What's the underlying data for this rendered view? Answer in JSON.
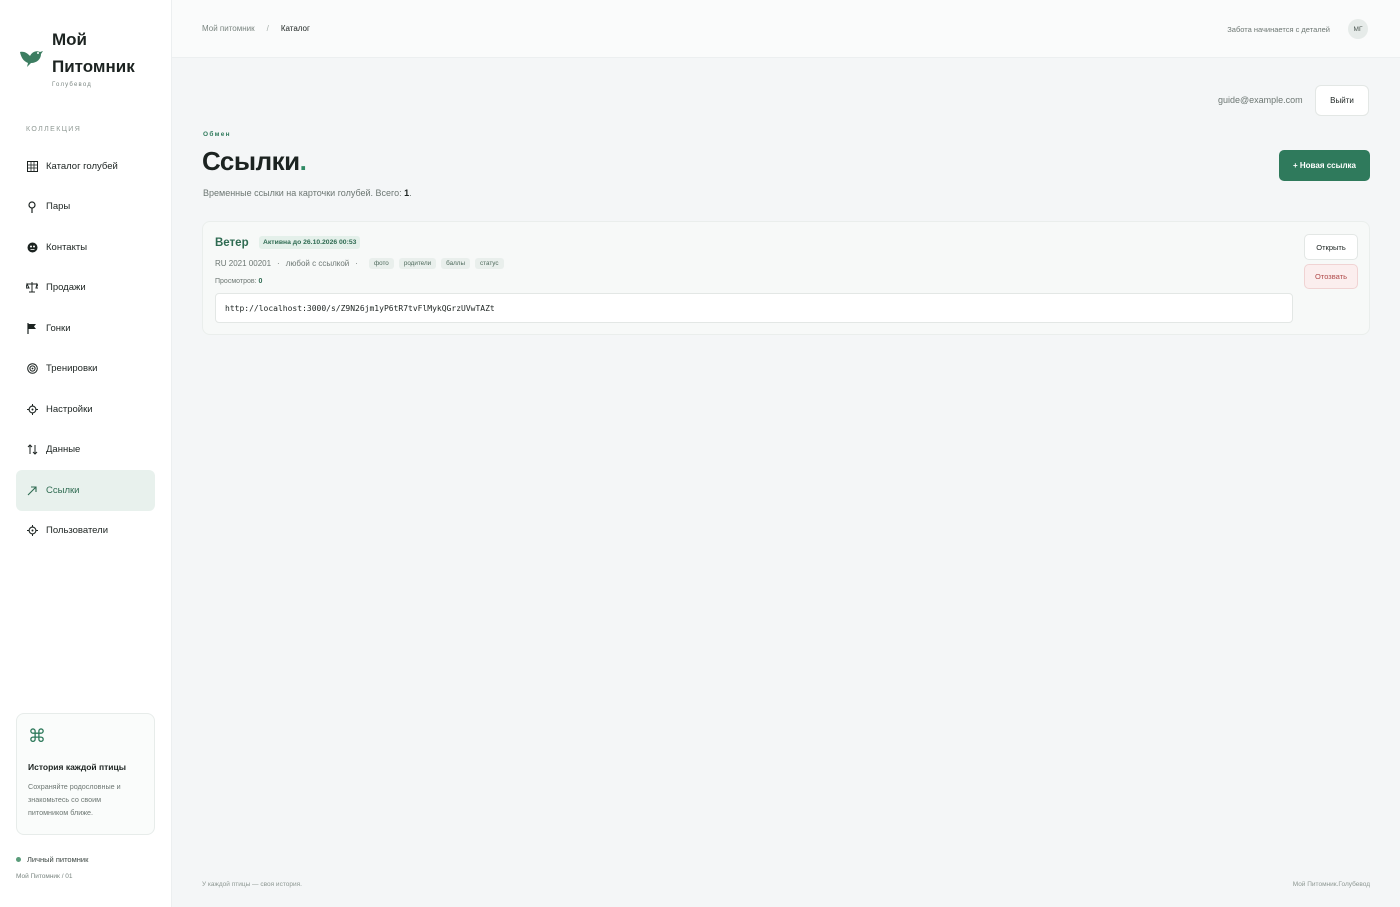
{
  "brand": {
    "title": "Мой Питомник",
    "subtitle": "Голубевод"
  },
  "sidebar": {
    "section_label": "КОЛЛЕКЦИЯ",
    "items": [
      {
        "label": "Каталог голубей",
        "icon": "grid-icon"
      },
      {
        "label": "Пары",
        "icon": "pin-icon"
      },
      {
        "label": "Контакты",
        "icon": "contacts-icon"
      },
      {
        "label": "Продажи",
        "icon": "scales-icon"
      },
      {
        "label": "Гонки",
        "icon": "flag-icon"
      },
      {
        "label": "Тренировки",
        "icon": "target-icon"
      },
      {
        "label": "Настройки",
        "icon": "gear-icon"
      },
      {
        "label": "Данные",
        "icon": "sort-arrows-icon"
      },
      {
        "label": "Ссылки",
        "icon": "link-arrow-icon",
        "active": true
      },
      {
        "label": "Пользователи",
        "icon": "users-icon"
      }
    ],
    "promo": {
      "icon": "command-icon",
      "title": "История каждой птицы",
      "text": "Сохраняйте родословные и знакомьтесь со своим питомником ближе."
    },
    "status": "Личный питомник",
    "version": "Мой Питомник / 01"
  },
  "topbar": {
    "breadcrumbs": [
      "Мой питомник",
      "Каталог"
    ],
    "tagline": "Забота начинается с деталей",
    "avatar_initials": "МГ"
  },
  "account": {
    "email": "guide@example.com",
    "logout_label": "Выйти"
  },
  "page": {
    "eyebrow": "Обмен",
    "title": "Ссылки",
    "title_dot": ".",
    "subtitle_prefix": "Временные ссылки на карточки голубей. Всего: ",
    "total": "1",
    "subtitle_suffix": ".",
    "new_button": "+ Новая ссылка"
  },
  "links": [
    {
      "name": "Ветер",
      "badge": "Активна до 26.10.2026 00:53",
      "ring": "RU 2021 00201",
      "sep": "·",
      "access": "любой с ссылкой",
      "chips": [
        "фото",
        "родители",
        "баллы",
        "статус"
      ],
      "views_label": "Просмотров:",
      "views": "0",
      "url": "http://localhost:3000/s/Z9N26jm1yP6tR7tvFlMykQGrzUVwTAZt",
      "open_label": "Открыть",
      "revoke_label": "Отозвать"
    }
  ],
  "footer": {
    "left": "У каждой птицы — своя история.",
    "right": "Мой Питомник.Голубевод"
  },
  "colors": {
    "accent": "#2f7a5c",
    "active_bg": "#e8f1ed",
    "danger": "#b04a4a"
  }
}
